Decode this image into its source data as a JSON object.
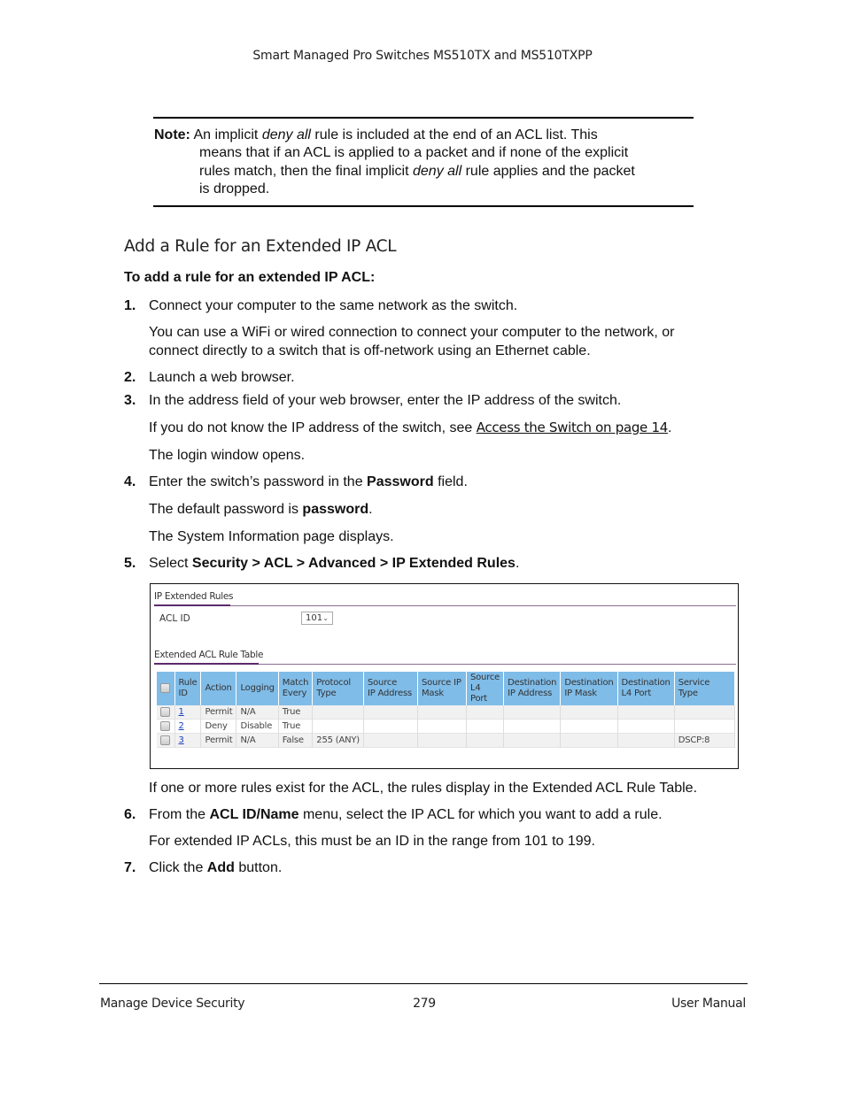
{
  "header": {
    "title": "Smart Managed Pro Switches MS510TX and MS510TXPP"
  },
  "note": {
    "label": "Note:",
    "line1_a": " An implicit ",
    "line1_i": "deny all",
    "line1_b": " rule is included at the end of an ACL list. This",
    "line2": "means that if an ACL is applied to a packet and if none of the explicit",
    "line3_a": "rules match, then the final implicit ",
    "line3_i": "deny all",
    "line3_b": " rule applies and the packet",
    "line4": "is dropped."
  },
  "section": {
    "heading": "Add a Rule for an Extended IP ACL",
    "lead": "To add a rule for an extended IP ACL:"
  },
  "steps": [
    {
      "num": "1.",
      "text": "Connect your computer to the same network as the switch."
    },
    {
      "num": "2.",
      "text": "Launch a web browser."
    },
    {
      "num": "3.",
      "text": "In the address field of your web browser, enter the IP address of the switch."
    },
    {
      "num": "4.",
      "text_a": "Enter the switch’s password in the ",
      "text_b": "Password",
      "text_c": " field."
    },
    {
      "num": "5.",
      "text_a": "Select ",
      "text_b": "Security > ACL > Advanced > IP Extended Rules",
      "text_c": "."
    },
    {
      "num": "6.",
      "text_a": "From the ",
      "text_b": "ACL ID/Name",
      "text_c": " menu, select the IP ACL for which you want to add a rule."
    },
    {
      "num": "7.",
      "text_a": "Click the ",
      "text_b": "Add",
      "text_c": " button."
    }
  ],
  "paras": {
    "p1_line1": "You can use a WiFi or wired connection to connect your computer to the network, or",
    "p1_line2": "connect directly to a switch that is off-network using an Ethernet cable.",
    "p3_a": "If you do not know the IP address of the switch, see ",
    "p3_link": "Access the Switch on page 14",
    "p3_b": ".",
    "p3b": "The login window opens.",
    "p4a_a": "The default password is ",
    "p4a_b": "password",
    "p4a_c": ".",
    "p4b": "The System Information page displays.",
    "p5": "If one or more rules exist for the ACL, the rules display in the Extended ACL Rule Table.",
    "p6": "For extended IP ACLs, this must be an ID in the range from 101 to 199."
  },
  "screenshot": {
    "title": "IP Extended Rules",
    "acl_id_label": "ACL ID",
    "acl_id_value": "101",
    "table_title": "Extended ACL Rule Table",
    "columns": [
      [
        "Rule",
        "ID"
      ],
      [
        "Action",
        ""
      ],
      [
        "Logging",
        ""
      ],
      [
        "Match",
        "Every"
      ],
      [
        "Protocol",
        "Type"
      ],
      [
        "Source",
        "IP Address"
      ],
      [
        "Source IP",
        "Mask"
      ],
      [
        "Source",
        "L4 Port"
      ],
      [
        "Destination",
        "IP Address"
      ],
      [
        "Destination",
        "IP Mask"
      ],
      [
        "Destination",
        "L4 Port"
      ],
      [
        "Service Type",
        ""
      ]
    ],
    "rows": [
      [
        "1",
        "Permit",
        "N/A",
        "True",
        "",
        "",
        "",
        "",
        "",
        "",
        "",
        ""
      ],
      [
        "2",
        "Deny",
        "Disable",
        "True",
        "",
        "",
        "",
        "",
        "",
        "",
        "",
        ""
      ],
      [
        "3",
        "Permit",
        "N/A",
        "False",
        "255 (ANY)",
        "",
        "",
        "",
        "",
        "",
        "",
        "DSCP:8"
      ]
    ]
  },
  "footer": {
    "left": "Manage Device Security",
    "center": "279",
    "right": "User Manual"
  }
}
